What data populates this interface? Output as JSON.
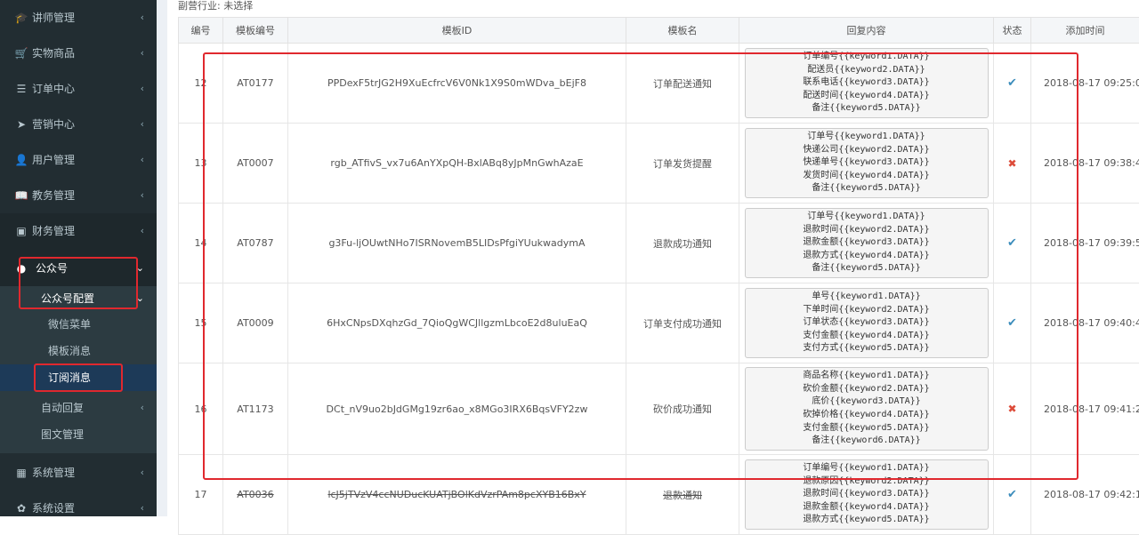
{
  "sidebar": {
    "items": [
      {
        "label": "讲师管理",
        "icon": "graduation-cap-icon",
        "glyph": "🎓",
        "arrow": "‹"
      },
      {
        "label": "实物商品",
        "icon": "cart-icon",
        "glyph": "🛒",
        "arrow": "‹"
      },
      {
        "label": "订单中心",
        "icon": "list-icon",
        "glyph": "☰",
        "arrow": "‹"
      },
      {
        "label": "营销中心",
        "icon": "paper-plane-icon",
        "glyph": "➤",
        "arrow": "‹"
      },
      {
        "label": "用户管理",
        "icon": "user-icon",
        "glyph": "👤",
        "arrow": "‹"
      },
      {
        "label": "教务管理",
        "icon": "book-icon",
        "glyph": "📖",
        "arrow": "‹"
      },
      {
        "label": "财务管理",
        "icon": "money-icon",
        "glyph": "▣",
        "arrow": "‹"
      }
    ],
    "wechat": {
      "label": "公众号",
      "glyph": "●",
      "arrow": "⌄"
    },
    "wechat_config": {
      "label": "公众号配置",
      "arrow": "⌄"
    },
    "sub_items": [
      "微信菜单",
      "模板消息",
      "订阅消息"
    ],
    "auto_reply": {
      "label": "自动回复",
      "arrow": "‹"
    },
    "articles": {
      "label": "图文管理"
    },
    "system": {
      "label": "系统管理",
      "glyph": "▦",
      "arrow": "‹"
    },
    "settings": {
      "label": "系统设置",
      "glyph": "✿",
      "arrow": "‹"
    }
  },
  "breadcrumb": "副营行业: 未选择",
  "table": {
    "headers": [
      "编号",
      "模板编号",
      "模板ID",
      "模板名",
      "回复内容",
      "状态",
      "添加时间"
    ],
    "rows": [
      {
        "no": "12",
        "code": "AT0177",
        "id": "PPDexF5trJG2H9XuEcfrcV6V0Nk1X9S0mWDva_bEjF8",
        "name": "订单配送通知",
        "reply": "订单编号{{keyword1.DATA}}\n配送员{{keyword2.DATA}}\n联系电话{{keyword3.DATA}}\n配送时间{{keyword4.DATA}}\n备注{{keyword5.DATA}}",
        "status": "ok",
        "status_glyph": "✔",
        "time": "2018-08-17 09:25:0"
      },
      {
        "no": "13",
        "code": "AT0007",
        "id": "rgb_ATfivS_vx7u6AnYXpQH-BxlABq8yJpMnGwhAzaE",
        "name": "订单发货提醒",
        "reply": "订单号{{keyword1.DATA}}\n快递公司{{keyword2.DATA}}\n快递单号{{keyword3.DATA}}\n发货时间{{keyword4.DATA}}\n备注{{keyword5.DATA}}",
        "status": "no",
        "status_glyph": "✖",
        "time": "2018-08-17 09:38:4"
      },
      {
        "no": "14",
        "code": "AT0787",
        "id": "g3Fu-ljOUwtNHo7ISRNovemB5LIDsPfgiYUukwadymA",
        "name": "退款成功通知",
        "reply": "订单号{{keyword1.DATA}}\n退款时间{{keyword2.DATA}}\n退款金额{{keyword3.DATA}}\n退款方式{{keyword4.DATA}}\n备注{{keyword5.DATA}}",
        "status": "ok",
        "status_glyph": "✔",
        "time": "2018-08-17 09:39:5"
      },
      {
        "no": "15",
        "code": "AT0009",
        "id": "6HxCNpsDXqhzGd_7QioQgWCJllgzmLbcoE2d8uluEaQ",
        "name": "订单支付成功通知",
        "reply": "单号{{keyword1.DATA}}\n下单时间{{keyword2.DATA}}\n订单状态{{keyword3.DATA}}\n支付金额{{keyword4.DATA}}\n支付方式{{keyword5.DATA}}",
        "status": "ok",
        "status_glyph": "✔",
        "time": "2018-08-17 09:40:4"
      },
      {
        "no": "16",
        "code": "AT1173",
        "id": "DCt_nV9uo2bJdGMg19zr6ao_x8MGo3IRX6BqsVFY2zw",
        "name": "砍价成功通知",
        "reply": "商品名称{{keyword1.DATA}}\n砍价金额{{keyword2.DATA}}\n底价{{keyword3.DATA}}\n砍掉价格{{keyword4.DATA}}\n支付金额{{keyword5.DATA}}\n备注{{keyword6.DATA}}",
        "status": "no",
        "status_glyph": "✖",
        "time": "2018-08-17 09:41:2"
      },
      {
        "no": "17",
        "code": "AT0036",
        "id": "lcJ5jTVzV4ccNUDucKUATjBOlKdVzrPAm8pcXYB16BxY",
        "name": "退款通知",
        "reply": "订单编号{{keyword1.DATA}}\n退款原因{{keyword2.DATA}}\n退款时间{{keyword3.DATA}}\n退款金额{{keyword4.DATA}}\n退款方式{{keyword5.DATA}}",
        "status": "ok",
        "status_glyph": "✔",
        "time": "2018-08-17 09:42:1"
      }
    ]
  },
  "colors": {
    "sidebar": "#222d32",
    "highlight": "#e0282e",
    "accent": "#3c8dbc"
  }
}
